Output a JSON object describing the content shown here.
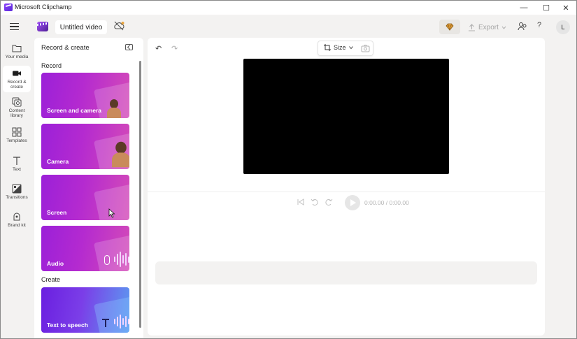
{
  "window": {
    "title": "Microsoft Clipchamp",
    "min_glyph": "—",
    "max_glyph": "☐",
    "close_glyph": "✕"
  },
  "header": {
    "project_title": "Untitled video",
    "export_label": "Export",
    "help_glyph": "?",
    "avatar_initial": "L"
  },
  "rail": {
    "items": [
      {
        "label": "Your media",
        "icon": "folder-icon"
      },
      {
        "label": "Record & create",
        "icon": "camera-icon"
      },
      {
        "label": "Content library",
        "icon": "content-library-icon"
      },
      {
        "label": "Templates",
        "icon": "templates-icon"
      },
      {
        "label": "Text",
        "icon": "text-icon"
      },
      {
        "label": "Transitions",
        "icon": "transitions-icon"
      },
      {
        "label": "Brand kit",
        "icon": "brand-kit-icon"
      }
    ]
  },
  "panel": {
    "title": "Record & create",
    "record_heading": "Record",
    "create_heading": "Create",
    "cards": [
      {
        "label": "Screen and camera"
      },
      {
        "label": "Camera"
      },
      {
        "label": "Screen"
      },
      {
        "label": "Audio"
      }
    ],
    "create_cards": [
      {
        "label": "Text to speech"
      }
    ]
  },
  "editor": {
    "undo_glyph": "↶",
    "redo_glyph": "↷",
    "size_label": "Size",
    "time_display": "0:00.00 / 0:00.00"
  },
  "colors": {
    "accent": "#9b20d8",
    "preview_bg": "#000000"
  }
}
